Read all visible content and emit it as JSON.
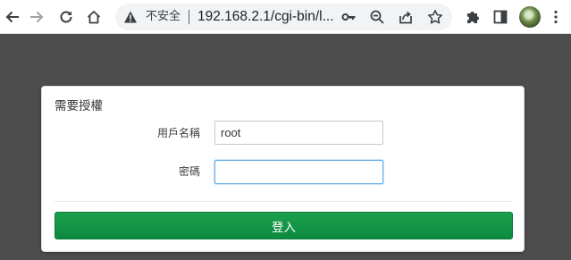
{
  "browser": {
    "security_text": "不安全",
    "url": "192.168.2.1/cgi-bin/l..."
  },
  "icons": {
    "back": "arrow-left-icon",
    "forward": "arrow-right-icon",
    "reload": "reload-icon",
    "home": "home-icon",
    "warning": "warning-triangle-icon",
    "key": "key-icon",
    "zoom": "zoom-icon",
    "share": "share-icon",
    "bookmark": "star-icon",
    "extensions": "puzzle-icon",
    "sidepanel": "side-panel-icon",
    "menu": "kebab-menu-icon"
  },
  "login": {
    "title": "需要授權",
    "username_label": "用戶名稱",
    "username_value": "root",
    "password_label": "密碼",
    "password_value": "",
    "submit_label": "登入"
  },
  "colors": {
    "page_background": "#4d4d4d",
    "button_green": "#0f8f40",
    "focus_border": "#66afe9"
  }
}
